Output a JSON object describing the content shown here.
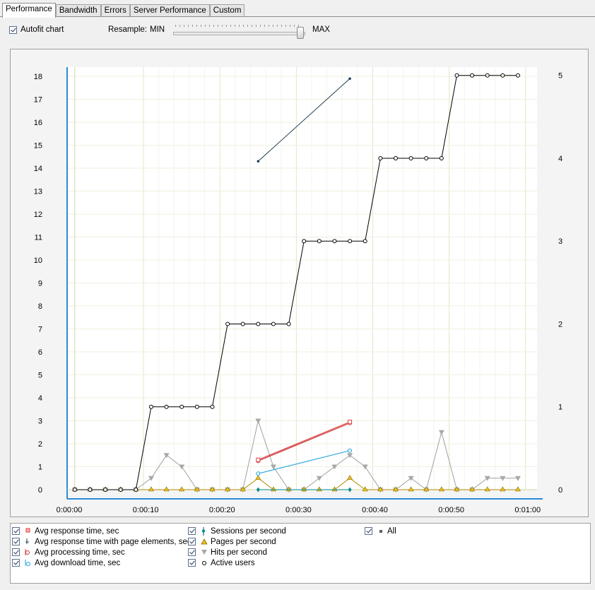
{
  "tabs": [
    "Performance",
    "Bandwidth",
    "Errors",
    "Server Performance",
    "Custom"
  ],
  "toolbar": {
    "autofit_label": "Autofit chart",
    "resample_label": "Resample:",
    "min_label": "MIN",
    "max_label": "MAX",
    "resample_level": 1.0
  },
  "chart_data": {
    "type": "line",
    "x_ticks": [
      "0:00:00",
      "0:00:10",
      "0:00:20",
      "0:00:30",
      "0:00:40",
      "0:00:50",
      "0:01:00"
    ],
    "x_range_seconds": [
      0,
      61.5
    ],
    "y_left_ticks": [
      "0",
      "1",
      "2",
      "3",
      "4",
      "5",
      "6",
      "7",
      "8",
      "9",
      "10",
      "11",
      "12",
      "13",
      "14",
      "15",
      "16",
      "17",
      "18"
    ],
    "y_left_range": [
      0,
      18.4
    ],
    "y_right_ticks": [
      "0",
      "1",
      "2",
      "3",
      "4",
      "5"
    ],
    "y_right_range": [
      0,
      5.1
    ],
    "grid": true,
    "series": [
      {
        "name": "Active users",
        "axis": "right",
        "color": "#000000",
        "marker": "circle",
        "x": [
          1,
          3,
          5,
          7,
          9,
          11,
          13,
          15,
          17,
          19,
          21,
          23,
          25,
          27,
          29,
          31,
          33,
          35,
          37,
          39,
          41,
          43,
          45,
          47,
          49,
          51,
          53,
          55,
          57,
          59
        ],
        "y": [
          0,
          0,
          0,
          0,
          0,
          1,
          1,
          1,
          1,
          1,
          2,
          2,
          2,
          2,
          2,
          3,
          3,
          3,
          3,
          3,
          4,
          4,
          4,
          4,
          4,
          5,
          5,
          5,
          5,
          5
        ]
      },
      {
        "name": "Hits per second",
        "axis": "left",
        "color": "#a0a0a0",
        "marker": "triangle-down",
        "x": [
          1,
          3,
          5,
          7,
          9,
          11,
          13,
          15,
          17,
          19,
          21,
          23,
          25,
          27,
          29,
          31,
          33,
          35,
          37,
          39,
          41,
          43,
          45,
          47,
          49,
          51,
          53,
          55,
          57,
          59
        ],
        "y": [
          0,
          0,
          0,
          0,
          0,
          0.5,
          1.5,
          1,
          0,
          0,
          0,
          0,
          3,
          1,
          0,
          0,
          0.5,
          1,
          1.5,
          1,
          0,
          0,
          0.5,
          0,
          2.5,
          0,
          0,
          0.5,
          0.5,
          0.5
        ]
      },
      {
        "name": "Pages per second",
        "axis": "left",
        "color": "#b08a00",
        "marker": "triangle-up",
        "x": [
          1,
          3,
          5,
          7,
          9,
          11,
          13,
          15,
          17,
          19,
          21,
          23,
          25,
          27,
          29,
          31,
          33,
          35,
          37,
          39,
          41,
          43,
          45,
          47,
          49,
          51,
          53,
          55,
          57,
          59
        ],
        "y": [
          0,
          0,
          0,
          0,
          0,
          0,
          0,
          0,
          0,
          0,
          0,
          0,
          0.5,
          0,
          0,
          0,
          0,
          0,
          0.5,
          0,
          0,
          0,
          0,
          0,
          0,
          0,
          0,
          0,
          0,
          0
        ]
      },
      {
        "name": "Sessions per second",
        "axis": "left",
        "color": "#008b8b",
        "marker": "diamond",
        "x": [
          25,
          37
        ],
        "y": [
          0,
          0
        ]
      },
      {
        "name": "Avg response time, sec",
        "axis": "left",
        "color": "#e03c3c",
        "marker": "square",
        "x": [
          25,
          37
        ],
        "y": [
          1.3,
          2.95
        ]
      },
      {
        "name": "Avg processing time, sec",
        "axis": "left",
        "color": "#c83232",
        "marker": "circle",
        "x": [
          25,
          37
        ],
        "y": [
          1.25,
          2.9
        ]
      },
      {
        "name": "Avg download time, sec",
        "axis": "left",
        "color": "#1aa0dc",
        "marker": "circle",
        "x": [
          25,
          37
        ],
        "y": [
          0.7,
          1.7
        ]
      },
      {
        "name": "Avg response time with page elements, sec",
        "axis": "left",
        "color": "#1e3c50",
        "marker": "dot",
        "x": [
          25,
          37
        ],
        "y": [
          14.3,
          17.9
        ]
      }
    ]
  },
  "legend": {
    "items": [
      {
        "label": "Avg response time, sec",
        "icon": "red-square-icon"
      },
      {
        "label": "Avg response time with page elements, sec",
        "icon": "dark-cross-icon"
      },
      {
        "label": "Avg processing time, sec",
        "icon": "red-circle-icon"
      },
      {
        "label": "Avg download time, sec",
        "icon": "blue-circle-icon"
      },
      {
        "label": "Sessions per second",
        "icon": "teal-diamond-icon"
      },
      {
        "label": "Pages per second",
        "icon": "yellow-triangle-icon"
      },
      {
        "label": "Hits per second",
        "icon": "grey-triangle-icon"
      },
      {
        "label": "Active users",
        "icon": "black-circle-icon"
      },
      {
        "label": "All",
        "icon": "grey-square-icon"
      }
    ]
  }
}
